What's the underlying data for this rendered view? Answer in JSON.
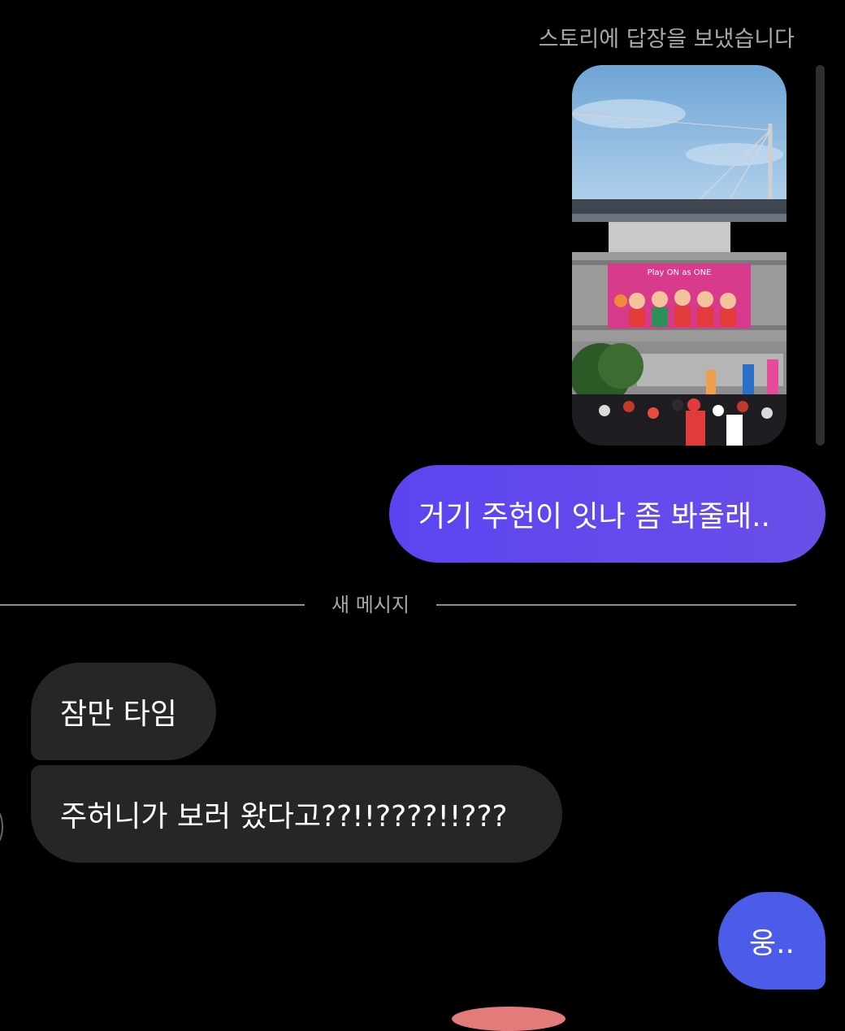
{
  "story_reply": {
    "label": "스토리에 답장을 보냈습니다",
    "banner_text": "Play ON as ONE"
  },
  "messages": [
    {
      "direction": "outgoing",
      "text": "거기 주헌이 잇나 좀 봐줄래.."
    },
    {
      "direction": "incoming",
      "text": "잠만 타임"
    },
    {
      "direction": "incoming",
      "text": "주허니가 보러 왔다고??!!????!!???"
    },
    {
      "direction": "outgoing",
      "text": "웅.."
    }
  ],
  "divider": {
    "label": "새 메시지"
  },
  "colors": {
    "background": "#000000",
    "outgoing_bubble": "#5b45f0",
    "outgoing_bubble_last": "#4a5ce8",
    "incoming_bubble": "#262626",
    "muted_text": "#a8a8a8"
  }
}
